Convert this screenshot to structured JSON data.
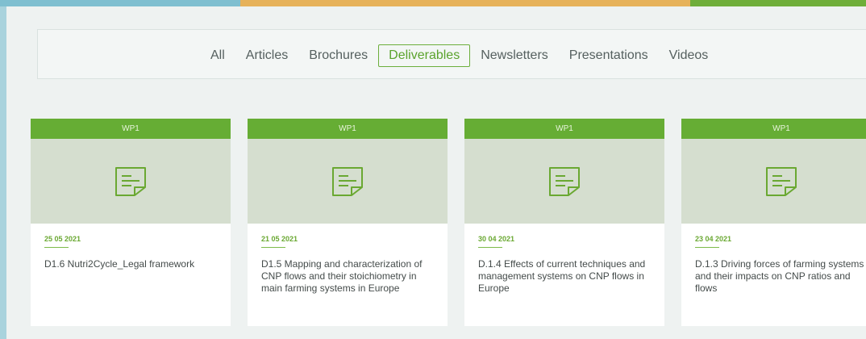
{
  "filters": [
    "All",
    "Articles",
    "Brochures",
    "Deliverables",
    "Newsletters",
    "Presentations",
    "Videos"
  ],
  "active_filter": "Deliverables",
  "colors": {
    "accent": "#66ad34",
    "thumb": "#d5decf"
  },
  "cards": [
    {
      "tag": "WP1",
      "date": "25 05 2021",
      "title": "D1.6 Nutri2Cycle_Legal framework",
      "icon": "document-icon"
    },
    {
      "tag": "WP1",
      "date": "21 05 2021",
      "title": "D1.5 Mapping and characterization of CNP flows and their stoichiometry in main farming systems in Europe",
      "icon": "document-icon"
    },
    {
      "tag": "WP1",
      "date": "30 04 2021",
      "title": "D.1.4 Effects of current techniques and management systems on CNP flows in Europe",
      "icon": "document-icon"
    },
    {
      "tag": "WP1",
      "date": "23 04 2021",
      "title": "D.1.3 Driving forces of farming systems and their impacts on CNP ratios and flows",
      "icon": "document-icon"
    }
  ]
}
